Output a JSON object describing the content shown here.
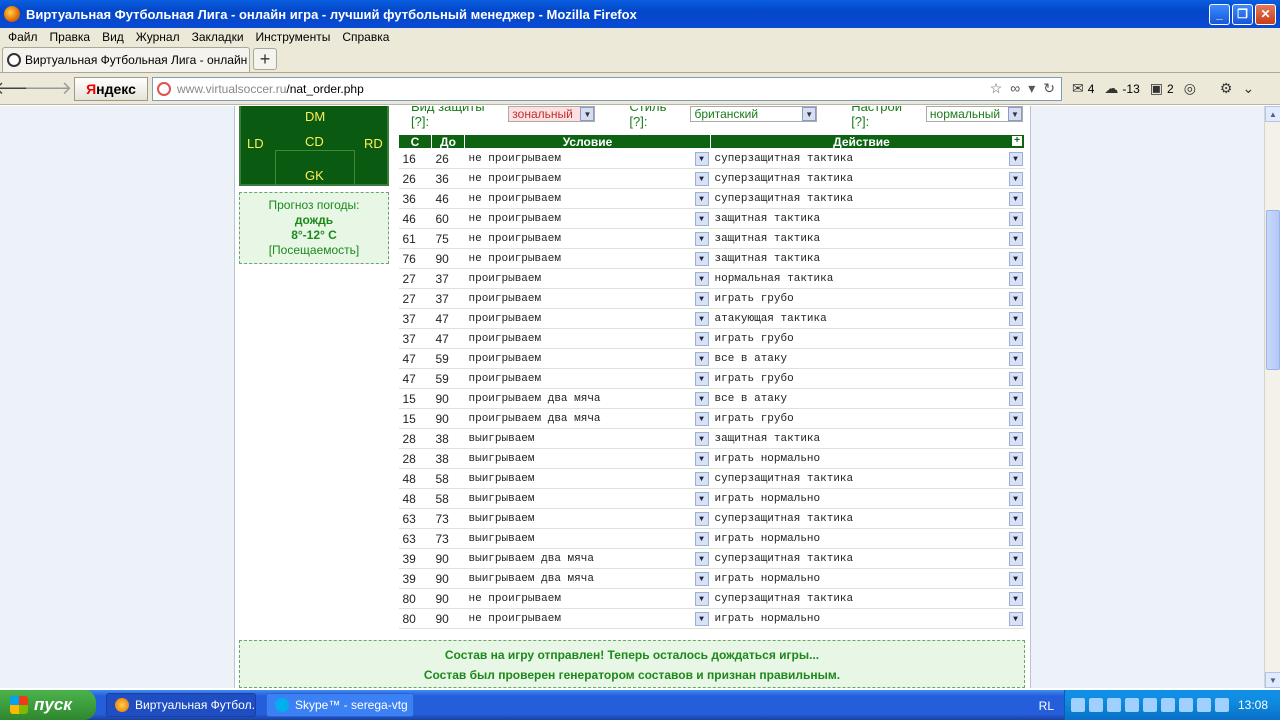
{
  "window": {
    "title": "Виртуальная Футбольная Лига - онлайн игра - лучший футбольный менеджер - Mozilla Firefox"
  },
  "menu": [
    "Файл",
    "Правка",
    "Вид",
    "Журнал",
    "Закладки",
    "Инструменты",
    "Справка"
  ],
  "tab": {
    "title": "Виртуальная Футбольная Лига - онлайн и..."
  },
  "nav": {
    "yandex_ya": "Я",
    "yandex_rest": "ндекс",
    "url_domain": "www.virtualsoccer.ru",
    "url_path": "/nat_order.php"
  },
  "extensions": {
    "mail_count": "4",
    "weather": "-13",
    "counter": "2"
  },
  "field": {
    "dm": "DM",
    "ld": "LD",
    "cd": "CD",
    "rd": "RD",
    "gk": "GK"
  },
  "weather_box": {
    "title": "Прогноз погоды:",
    "condition": "дождь",
    "temp": "8°-12° C",
    "attendance": "[Посещаемость]"
  },
  "settings": {
    "defense_label": "Вид защиты [?]:",
    "defense_value": "зональный",
    "style_label": "Стиль [?]:",
    "style_value": "британский",
    "mood_label": "Настрой [?]:",
    "mood_value": "нормальный"
  },
  "table": {
    "headers": {
      "from": "С",
      "to": "До",
      "condition": "Условие",
      "action": "Действие",
      "add": "+"
    },
    "rows": [
      {
        "from": "16",
        "to": "26",
        "condition": "не проигрываем",
        "action": "суперзащитная тактика"
      },
      {
        "from": "26",
        "to": "36",
        "condition": "не проигрываем",
        "action": "суперзащитная тактика"
      },
      {
        "from": "36",
        "to": "46",
        "condition": "не проигрываем",
        "action": "суперзащитная тактика"
      },
      {
        "from": "46",
        "to": "60",
        "condition": "не проигрываем",
        "action": "защитная тактика"
      },
      {
        "from": "61",
        "to": "75",
        "condition": "не проигрываем",
        "action": "защитная тактика"
      },
      {
        "from": "76",
        "to": "90",
        "condition": "не проигрываем",
        "action": "защитная тактика"
      },
      {
        "from": "27",
        "to": "37",
        "condition": "проигрываем",
        "action": "нормальная тактика"
      },
      {
        "from": "27",
        "to": "37",
        "condition": "проигрываем",
        "action": "играть грубо"
      },
      {
        "from": "37",
        "to": "47",
        "condition": "проигрываем",
        "action": "атакующая тактика"
      },
      {
        "from": "37",
        "to": "47",
        "condition": "проигрываем",
        "action": "играть грубо"
      },
      {
        "from": "47",
        "to": "59",
        "condition": "проигрываем",
        "action": "все в атаку"
      },
      {
        "from": "47",
        "to": "59",
        "condition": "проигрываем",
        "action": "играть грубо"
      },
      {
        "from": "15",
        "to": "90",
        "condition": "проигрываем два мяча",
        "action": "все в атаку"
      },
      {
        "from": "15",
        "to": "90",
        "condition": "проигрываем два мяча",
        "action": "играть грубо"
      },
      {
        "from": "28",
        "to": "38",
        "condition": "выигрываем",
        "action": "защитная тактика"
      },
      {
        "from": "28",
        "to": "38",
        "condition": "выигрываем",
        "action": "играть нормально"
      },
      {
        "from": "48",
        "to": "58",
        "condition": "выигрываем",
        "action": "суперзащитная тактика"
      },
      {
        "from": "48",
        "to": "58",
        "condition": "выигрываем",
        "action": "играть нормально"
      },
      {
        "from": "63",
        "to": "73",
        "condition": "выигрываем",
        "action": "суперзащитная тактика"
      },
      {
        "from": "63",
        "to": "73",
        "condition": "выигрываем",
        "action": "играть нормально"
      },
      {
        "from": "39",
        "to": "90",
        "condition": "выигрываем два мяча",
        "action": "суперзащитная тактика"
      },
      {
        "from": "39",
        "to": "90",
        "condition": "выигрываем два мяча",
        "action": "играть нормально"
      },
      {
        "from": "80",
        "to": "90",
        "condition": "не проигрываем",
        "action": "суперзащитная тактика"
      },
      {
        "from": "80",
        "to": "90",
        "condition": "не проигрываем",
        "action": "играть нормально"
      }
    ]
  },
  "message": {
    "line1": "Состав на игру отправлен! Теперь осталось дождаться игры...",
    "line2": "Состав был проверен генератором составов и признан правильным."
  },
  "taskbar": {
    "start": "пуск",
    "task1": "Виртуальная Футбол...",
    "task2": "Skype™ - serega-vtg",
    "lang": "RL",
    "clock": "13:08"
  },
  "colors": {
    "accent_green": "#0d6312",
    "page_bg": "#edf1f8",
    "message_green": "#1a8a1a"
  }
}
